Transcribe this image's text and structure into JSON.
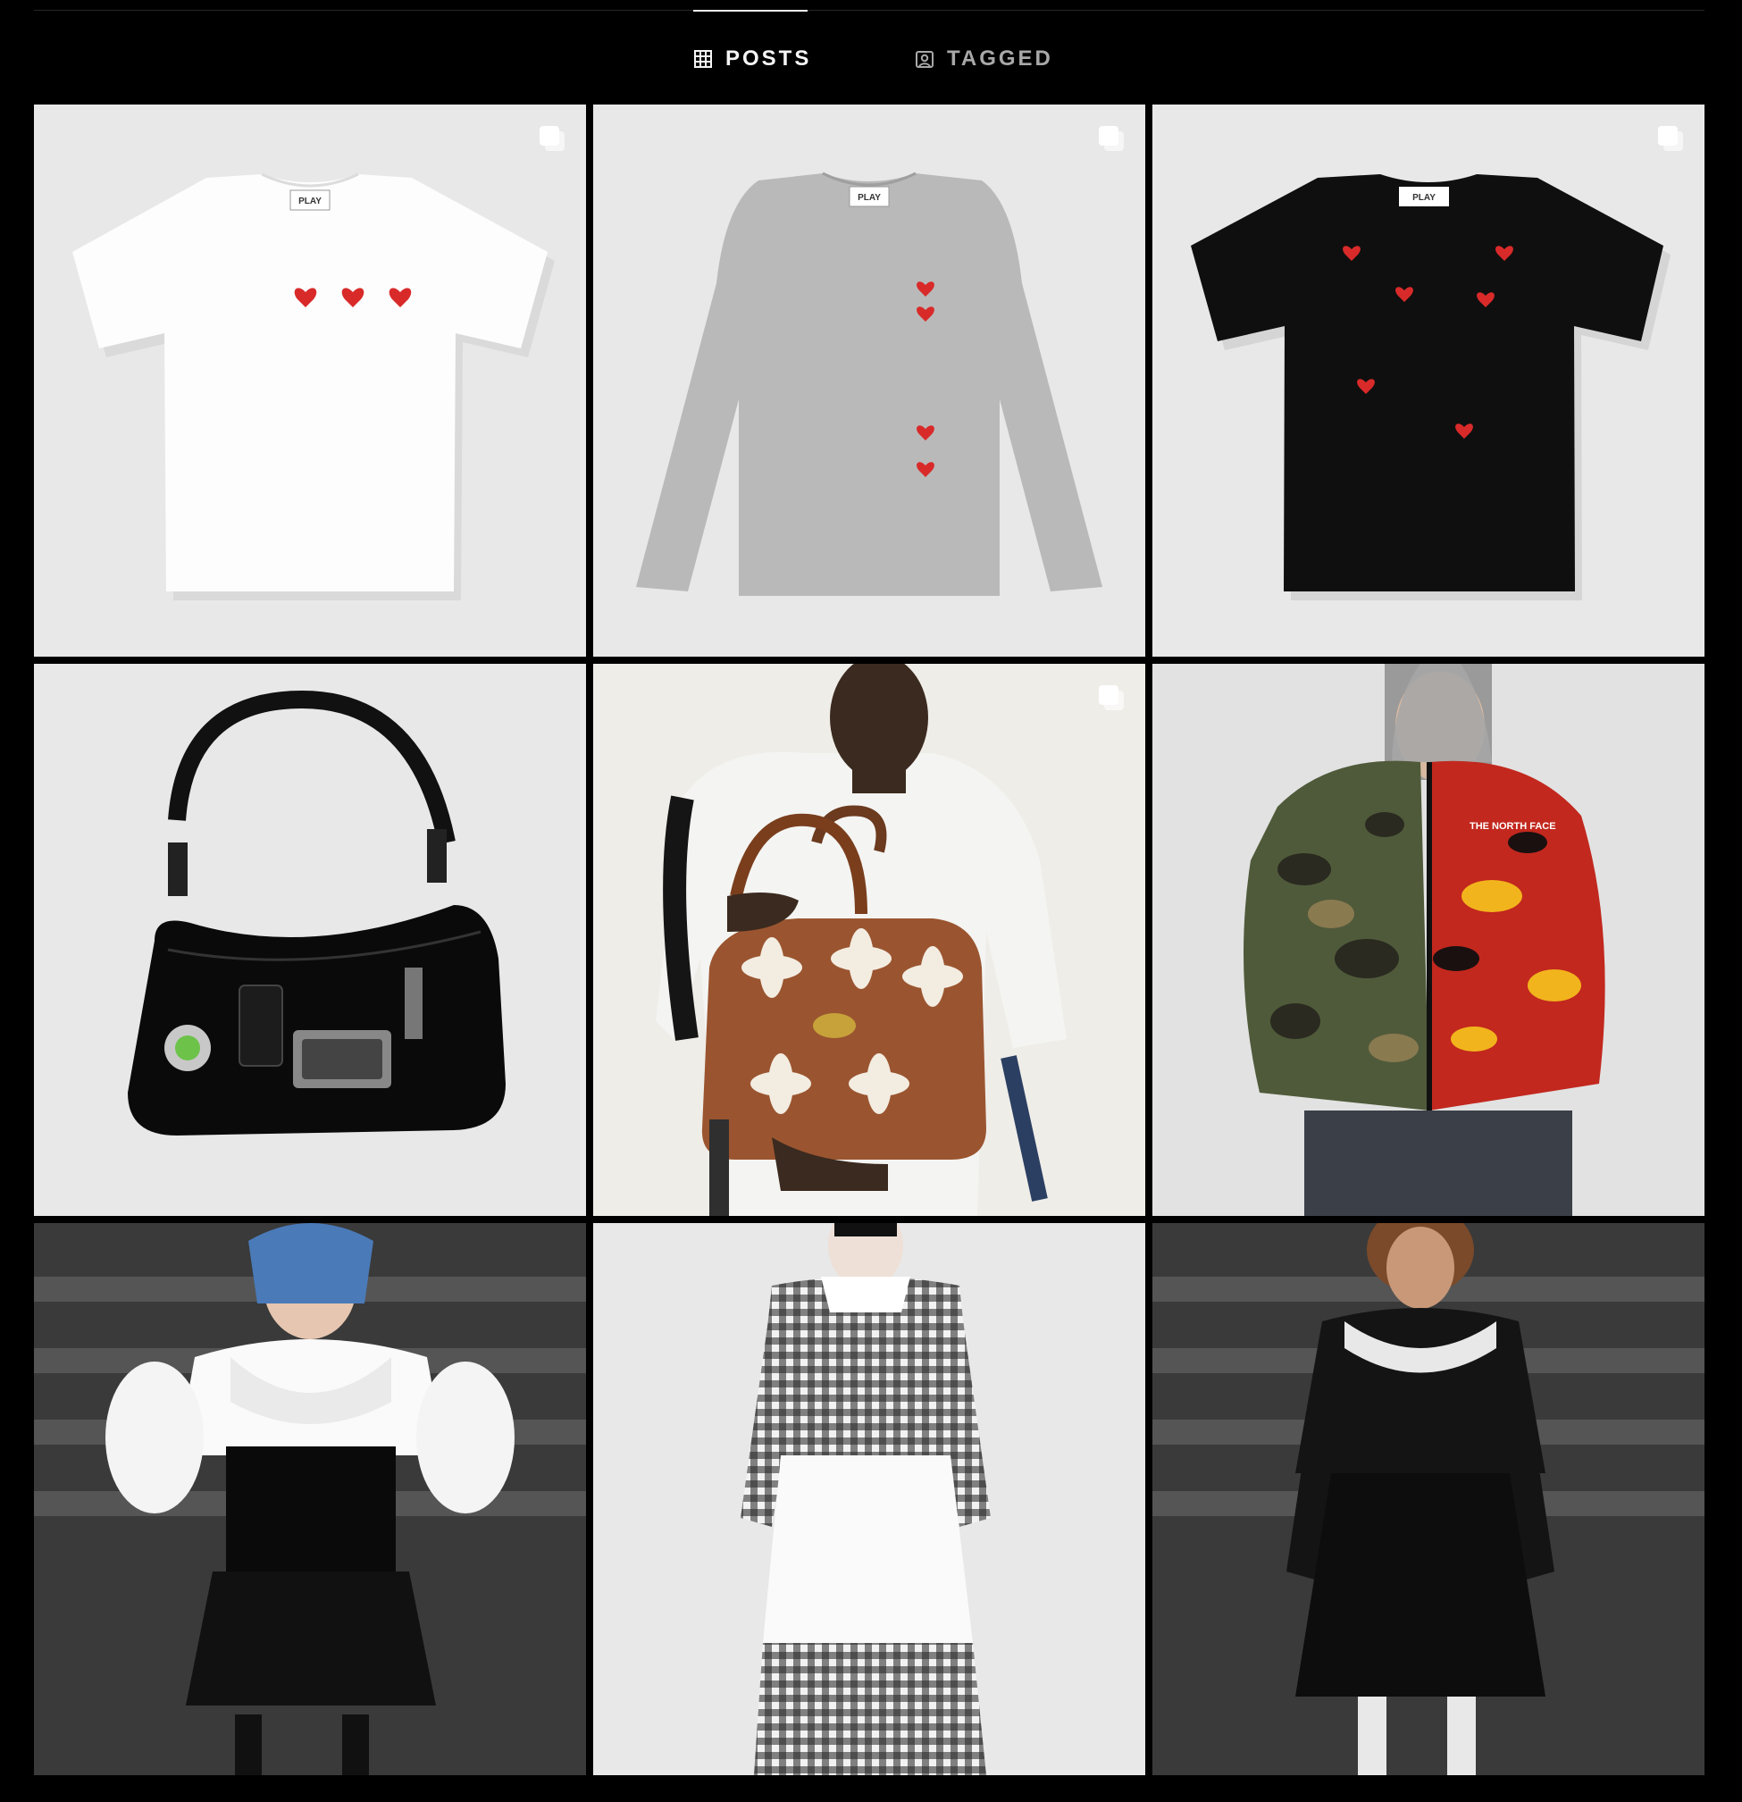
{
  "tabs": [
    {
      "label": "POSTS",
      "icon": "grid-icon",
      "active": true
    },
    {
      "label": "TAGGED",
      "icon": "tagged-icon",
      "active": false
    }
  ],
  "posts": [
    {
      "subject": "white tee",
      "label": "PLAY",
      "multi": true
    },
    {
      "subject": "grey long sleeve",
      "label": "PLAY",
      "multi": true
    },
    {
      "subject": "black tee",
      "label": "PLAY",
      "multi": true
    },
    {
      "subject": "black shoulder bag",
      "multi": false
    },
    {
      "subject": "model with brown bag",
      "multi": true
    },
    {
      "subject": "camo puffer",
      "label": "THE NORTH FACE",
      "multi": false
    },
    {
      "subject": "runway look",
      "multi": false
    },
    {
      "subject": "gingham look",
      "multi": false
    },
    {
      "subject": "black lace look",
      "multi": false
    }
  ],
  "colors": {
    "background": "#000000",
    "active_tab": "#f5f5f5",
    "inactive_tab": "#a8a8a8",
    "heart": "#d92a2a"
  }
}
